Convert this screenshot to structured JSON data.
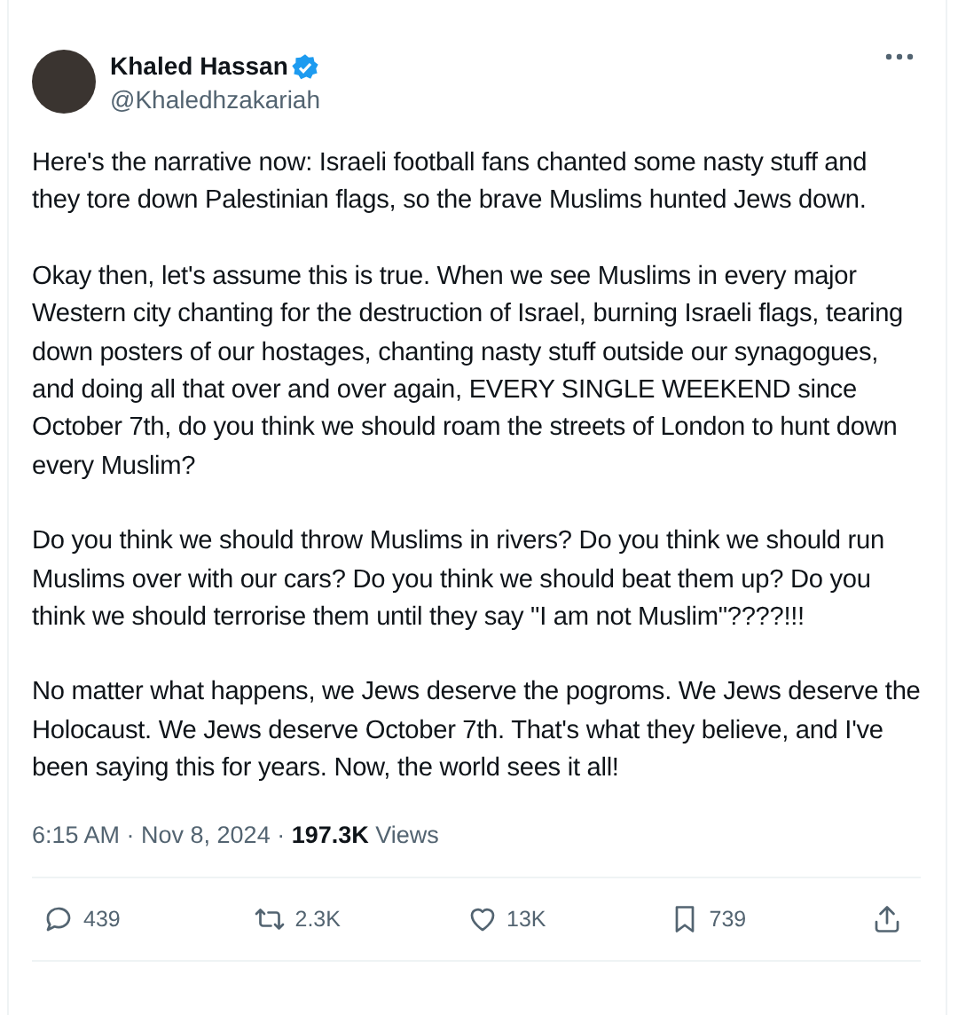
{
  "author": {
    "name": "Khaled Hassan",
    "handle": "@Khaledhzakariah",
    "verified": true
  },
  "paragraphs": [
    "Here's the narrative now: Israeli football fans chanted some nasty stuff and they tore down Palestinian flags, so the brave Muslims hunted Jews down.",
    "Okay then, let's assume this is true. When we see Muslims in every major Western city chanting for the destruction of Israel, burning Israeli flags, tearing down posters of our hostages, chanting nasty stuff outside our synagogues, and doing all that over and over again, EVERY SINGLE WEEKEND since October 7th, do you think we should roam the streets of London to hunt down every Muslim?",
    "Do you think we should throw Muslims in rivers? Do you think we should run Muslims over with our cars? Do you think we should beat them up? Do you think we should terrorise them until they say \"I am not Muslim\"????!!!",
    "No matter what happens, we Jews deserve the pogroms. We Jews deserve the Holocaust. We Jews deserve October 7th. That's what they believe, and I've been saying this for years. Now, the world sees it all!"
  ],
  "meta": "6:15 AM · Nov 8, 2024 · **197.3K** Views",
  "actions": [
    {
      "kind": "reply",
      "count": "439"
    },
    {
      "kind": "repost",
      "count": "2.3K"
    },
    {
      "kind": "like",
      "count": "13K"
    },
    {
      "kind": "bookmark",
      "count": "739"
    },
    {
      "kind": "share"
    }
  ]
}
